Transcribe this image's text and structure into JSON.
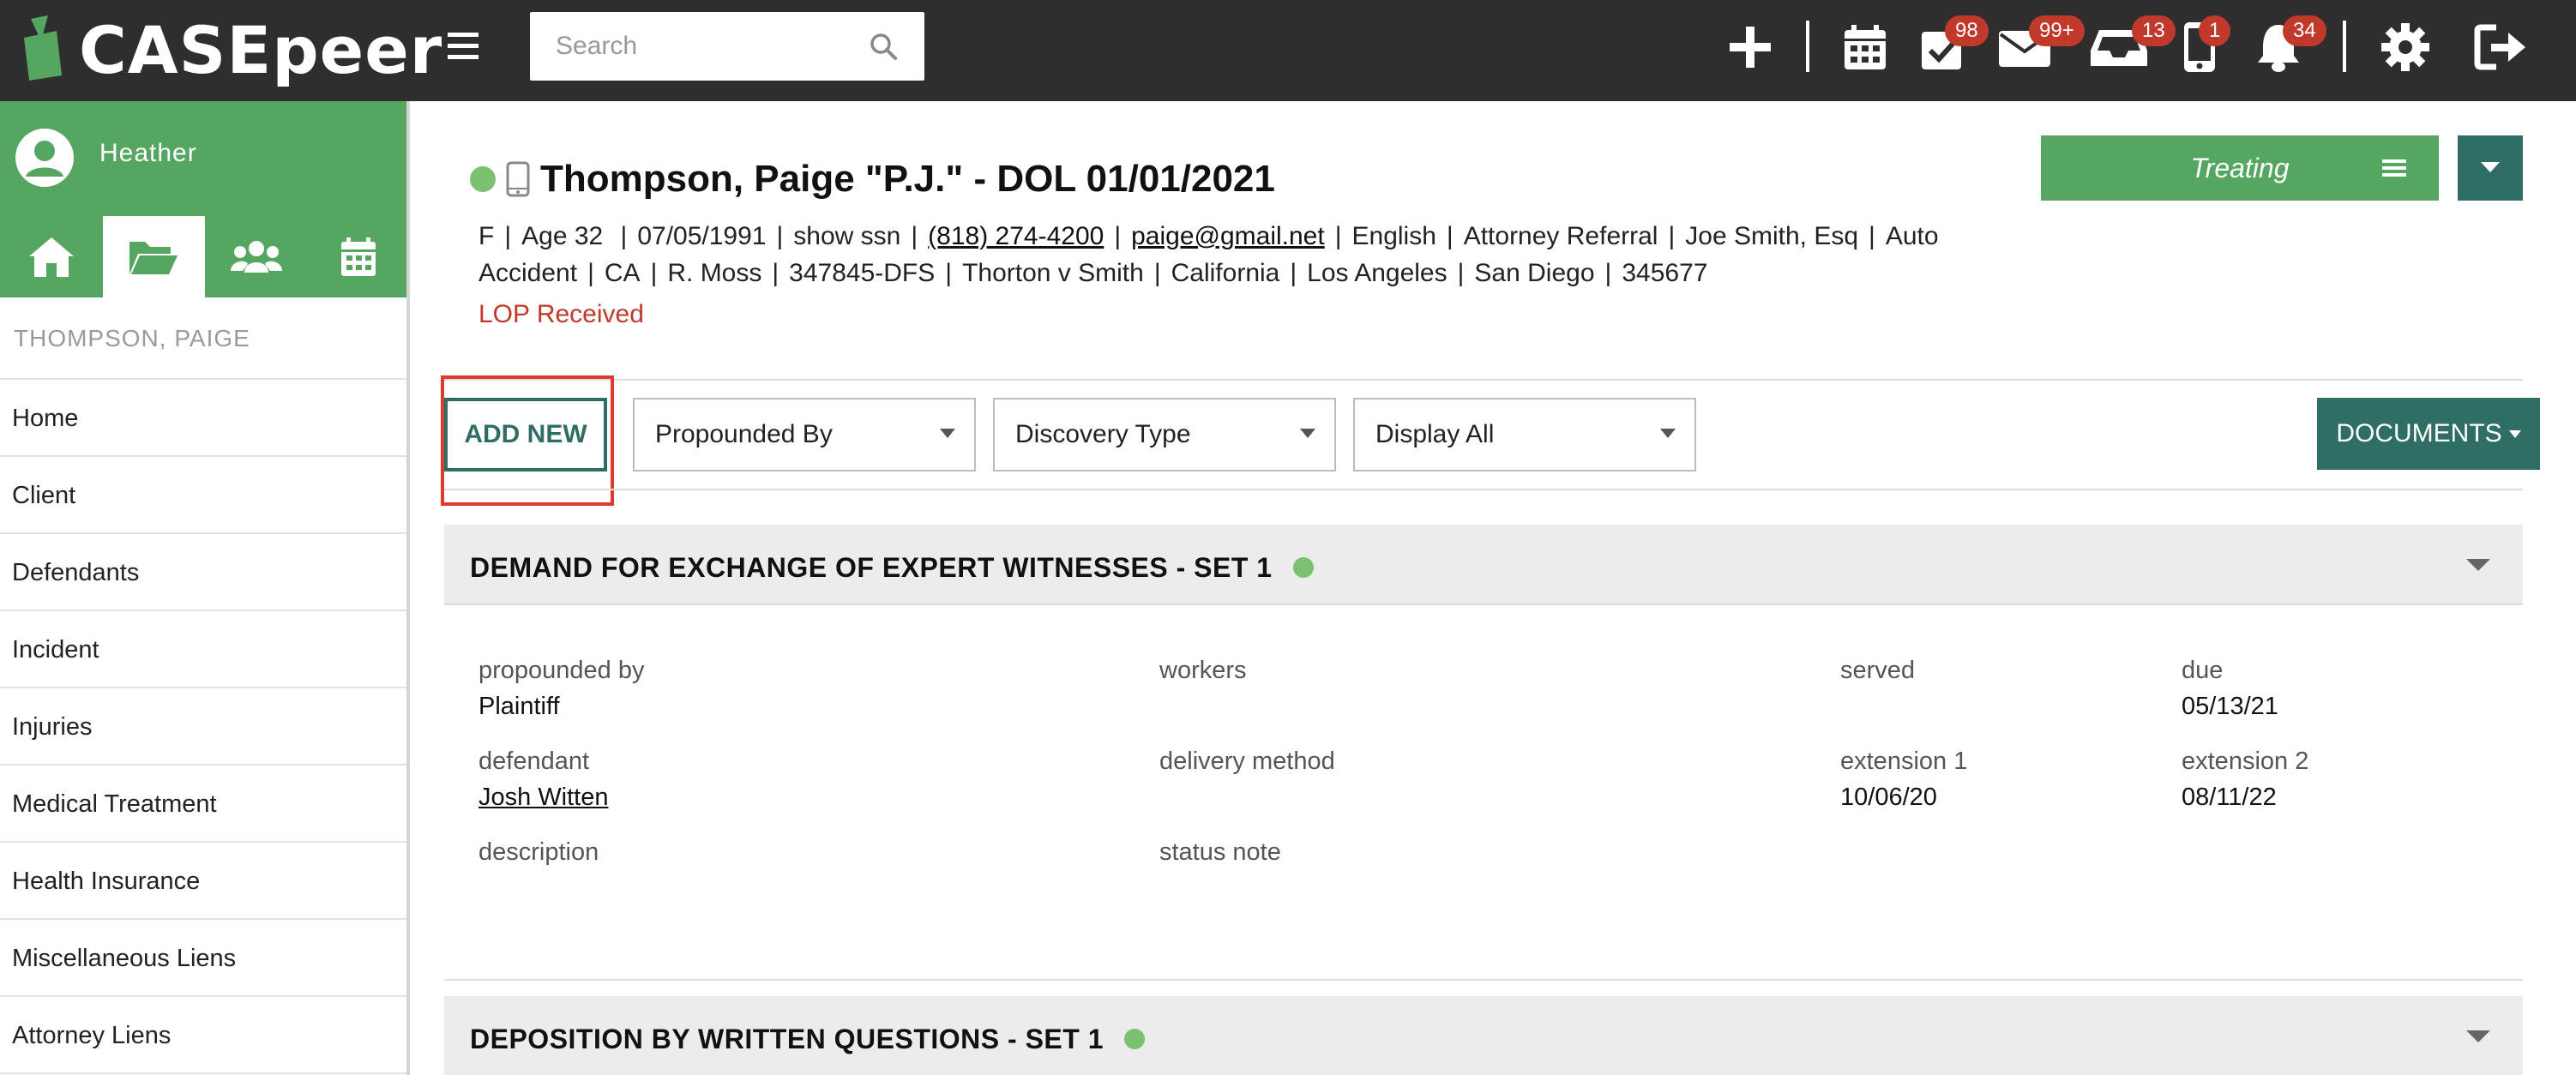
{
  "app": {
    "logo_text": "CASEpeer",
    "search_placeholder": "Search"
  },
  "topbar": {
    "badges": {
      "tasks": "98",
      "mail": "99+",
      "inbox": "13",
      "phone": "1",
      "notifications": "34"
    },
    "icons": [
      "plus-icon",
      "calendar-icon",
      "tasks-icon",
      "mail-icon",
      "inbox-icon",
      "phone-icon",
      "bell-icon",
      "gear-icon",
      "logout-icon"
    ]
  },
  "sidebar": {
    "user_name": "Heather",
    "client_header": "THOMPSON, PAIGE",
    "items": [
      {
        "label": "Home"
      },
      {
        "label": "Client"
      },
      {
        "label": "Defendants"
      },
      {
        "label": "Incident"
      },
      {
        "label": "Injuries"
      },
      {
        "label": "Medical Treatment"
      },
      {
        "label": "Health Insurance"
      },
      {
        "label": "Miscellaneous Liens"
      },
      {
        "label": "Attorney Liens"
      }
    ]
  },
  "case": {
    "title": "Thompson, Paige \"P.J.\" - DOL 01/01/2021",
    "info_line1": [
      "F",
      "Age 32 ",
      "07/05/1991",
      "show ssn",
      "(818) 274-4200",
      "paige@gmail.net",
      "English",
      "Attorney Referral",
      "Joe Smith, Esq",
      "Auto"
    ],
    "info_line2": [
      "Accident",
      "CA",
      "R. Moss",
      "347845-DFS",
      "Thorton v Smith",
      "California",
      "Los Angeles",
      "San Diego",
      "345677"
    ],
    "lop": "LOP Received",
    "status_button": "Treating"
  },
  "toolbar": {
    "add_new": "ADD NEW",
    "propounded_by": "Propounded By",
    "discovery_type": "Discovery Type",
    "display_all": "Display All",
    "documents": "DOCUMENTS"
  },
  "sections": [
    {
      "title": "DEMAND FOR EXCHANGE OF EXPERT WITNESSES - SET 1",
      "fields": {
        "propounded_by_label": "propounded by",
        "propounded_by_value": "Plaintiff",
        "workers_label": "workers",
        "served_label": "served",
        "due_label": "due",
        "due_value": "05/13/21",
        "defendant_label": "defendant",
        "defendant_value": "Josh Witten",
        "delivery_method_label": "delivery method",
        "extension1_label": "extension 1",
        "extension1_value": "10/06/20",
        "extension2_label": "extension 2",
        "extension2_value": "08/11/22",
        "description_label": "description",
        "status_note_label": "status note"
      }
    },
    {
      "title": "DEPOSITION BY WRITTEN QUESTIONS - SET 1"
    }
  ],
  "colors": {
    "topbar": "#2e2e2e",
    "brand_green": "#55a660",
    "dark_teal": "#2f6e65",
    "badge_red": "#c0392b",
    "highlight_red": "#e03a2e",
    "status_dot": "#7cc072"
  }
}
